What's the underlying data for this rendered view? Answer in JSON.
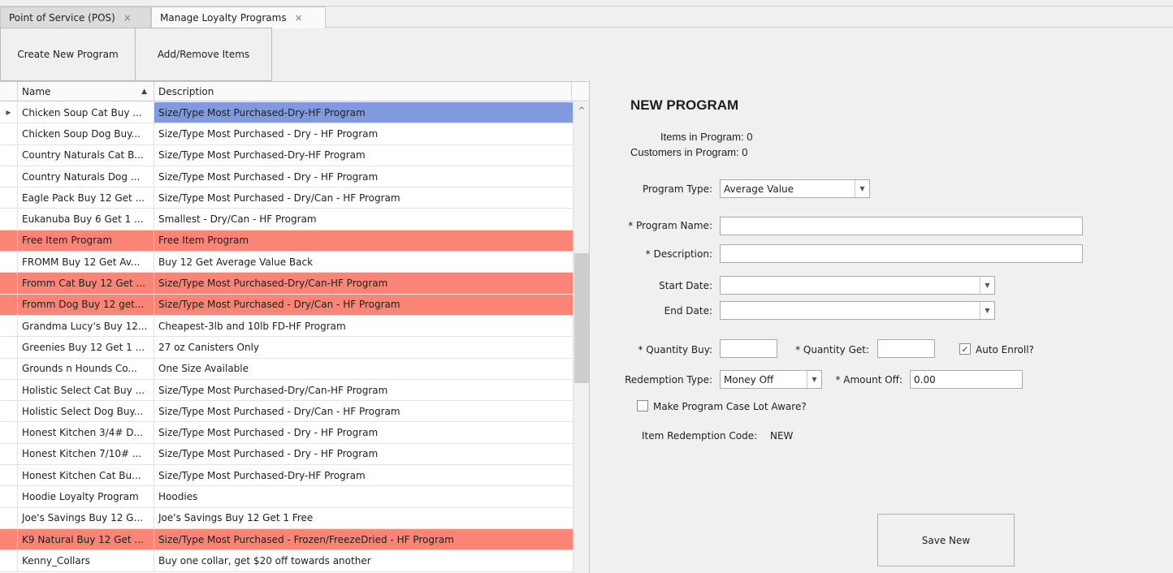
{
  "tabs": [
    {
      "label": "Point of Service (POS)",
      "close": "×"
    },
    {
      "label": "Manage Loyalty Programs",
      "close": "×"
    }
  ],
  "toolbar": {
    "create_label": "Create New Program",
    "addremove_label": "Add/Remove Items"
  },
  "grid": {
    "columns": [
      "Name",
      "Description"
    ],
    "sort_icon": "▲",
    "row_indicator": "▶",
    "scroll_up": "^",
    "rows": [
      {
        "name": "Chicken Soup Cat Buy ...",
        "description": "Size/Type Most Purchased-Dry-HF Program"
      },
      {
        "name": "Chicken Soup Dog Buy...",
        "description": "Size/Type Most Purchased - Dry - HF Program"
      },
      {
        "name": "Country Naturals Cat B...",
        "description": "Size/Type Most Purchased-Dry-HF Program"
      },
      {
        "name": "Country Naturals Dog ...",
        "description": "Size/Type Most Purchased - Dry - HF Program"
      },
      {
        "name": "Eagle Pack Buy 12 Get ...",
        "description": "Size/Type Most Purchased - Dry/Can - HF Program"
      },
      {
        "name": "Eukanuba Buy 6 Get 1 ...",
        "description": "Smallest - Dry/Can - HF Program"
      },
      {
        "name": "Free Item Program",
        "description": "Free Item Program"
      },
      {
        "name": "FROMM Buy 12 Get Av...",
        "description": "Buy 12 Get Average Value Back"
      },
      {
        "name": "Fromm Cat Buy 12 Get ...",
        "description": "Size/Type Most Purchased-Dry/Can-HF Program"
      },
      {
        "name": "Fromm Dog Buy 12 get...",
        "description": "Size/Type Most Purchased - Dry/Can - HF Program"
      },
      {
        "name": "Grandma Lucy's Buy 12...",
        "description": "Cheapest-3lb and 10lb FD-HF Program"
      },
      {
        "name": "Greenies Buy 12 Get 1 ...",
        "description": "27 oz Canisters Only"
      },
      {
        "name": "Grounds n Hounds Co...",
        "description": "One Size Available"
      },
      {
        "name": "Holistic Select Cat Buy ...",
        "description": "Size/Type Most Purchased-Dry/Can-HF Program"
      },
      {
        "name": "Holistic Select Dog Buy...",
        "description": "Size/Type Most Purchased - Dry/Can - HF Program"
      },
      {
        "name": "Honest Kitchen 3/4# D...",
        "description": "Size/Type Most Purchased - Dry - HF Program"
      },
      {
        "name": "Honest Kitchen 7/10# ...",
        "description": "Size/Type Most Purchased - Dry - HF Program"
      },
      {
        "name": "Honest Kitchen Cat Bu...",
        "description": "Size/Type Most Purchased-Dry-HF Program"
      },
      {
        "name": "Hoodie Loyalty Program",
        "description": "Hoodies"
      },
      {
        "name": "Joe's Savings Buy 12 G...",
        "description": "Joe's Savings Buy 12 Get 1 Free"
      },
      {
        "name": "K9 Natural Buy 12 Get ...",
        "description": "Size/Type Most Purchased - Frozen/FreezeDried - HF Program"
      },
      {
        "name": "Kenny_Collars",
        "description": "Buy one collar, get $20 off towards another"
      }
    ]
  },
  "form": {
    "title": "NEW PROGRAM",
    "items_in_program": "Items in Program: 0",
    "customers_in_program": "Customers in Program: 0",
    "program_type_label": "Program Type:",
    "program_type_value": "Average Value",
    "program_name_label": "* Program Name:",
    "program_name_value": "",
    "description_label": "* Description:",
    "description_value": "",
    "start_date_label": "Start Date:",
    "start_date_value": "",
    "end_date_label": "End Date:",
    "end_date_value": "",
    "quantity_buy_label": "* Quantity Buy:",
    "quantity_buy_value": "",
    "quantity_get_label": "* Quantity Get:",
    "quantity_get_value": "",
    "auto_enroll_label": "Auto Enroll?",
    "auto_enroll_mark": "✓",
    "redemption_type_label": "Redemption Type:",
    "redemption_type_value": "Money Off",
    "amount_off_label": "* Amount Off:",
    "amount_off_value": "0.00",
    "case_lot_label": "Make Program Case Lot Aware?",
    "redemption_code_label": "Item Redemption Code:",
    "redemption_code_value": "NEW",
    "save_label": "Save New",
    "dropdown_arrow": "▼"
  },
  "colors": {
    "selected_row": "#7f9ade",
    "highlight_row": "#fa8475"
  }
}
